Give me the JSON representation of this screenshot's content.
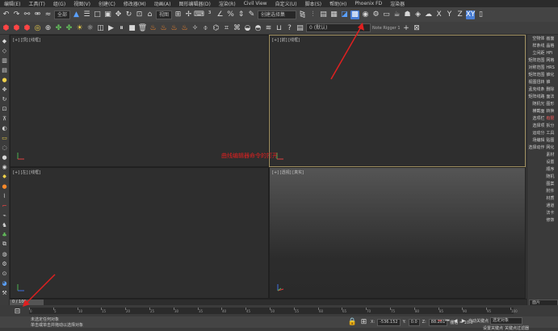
{
  "menubar": [
    "编辑(E)",
    "工具(T)",
    "组(G)",
    "视图(V)",
    "创建(C)",
    "修改器(M)",
    "动画(A)",
    "图形编辑器(D)",
    "渲染(R)",
    "Civil View",
    "自定义(U)",
    "脚本(S)",
    "帮助(H)",
    "Phoenix FD",
    "渲染器"
  ],
  "toolbar1": {
    "filter_dropdown": "全部",
    "selection_set_dropdown": "创建选择集"
  },
  "toolbar2": {
    "layer_dropdown": "0 (默认)",
    "rig_label": "Note Rigger 1"
  },
  "viewports": {
    "top_left_label": "[+] [顶] [线框]",
    "top_right_label": "[+] [前] [线框]",
    "bottom_left_label": "[+] [左] [线框]",
    "bottom_right_label": "[+] [透视] [真实]",
    "annotation": "曲线编辑器命令的打开"
  },
  "right_panel": [
    [
      "空物体",
      "画面"
    ],
    [
      "样条线",
      "晶格"
    ],
    [
      "立间距",
      "HFi"
    ],
    [
      "矩阵范围",
      "网格"
    ],
    [
      "对称范围",
      "HRS"
    ],
    [
      "矩阵范围",
      "锥化"
    ],
    [
      "视图扭转",
      "锥"
    ],
    [
      "孟克线条",
      "删除"
    ],
    [
      "矩阵线路",
      "面法"
    ],
    [
      "随机光",
      "图形"
    ],
    [
      "横截面",
      "转换"
    ],
    [
      "选项栏",
      "有限"
    ],
    [
      "选择项",
      "拆分"
    ],
    [
      "运动分",
      "工具"
    ],
    [
      "场编辑",
      "贴图"
    ],
    [
      "选择动作",
      "网化"
    ],
    [
      "",
      "素材"
    ],
    [
      "",
      "设置"
    ],
    [
      "",
      "顺序"
    ],
    [
      "",
      "随机"
    ],
    [
      "",
      "图案"
    ],
    [
      "",
      "附件"
    ],
    [
      "",
      "材质"
    ],
    [
      "",
      "通道"
    ],
    [
      "",
      "法卡"
    ],
    [
      "",
      "修饰"
    ]
  ],
  "right_panel_dropdown": "面片",
  "timeline": {
    "slider_label": "0 / 100",
    "ticks": [
      "0",
      "5",
      "10",
      "15",
      "20",
      "25",
      "30",
      "35",
      "40",
      "45",
      "50",
      "55",
      "60",
      "65",
      "70",
      "75",
      "80",
      "85",
      "90",
      "95",
      "100"
    ]
  },
  "status": {
    "line1": "未选定任何对象",
    "line2": "单击或单击并拖动以选择对象",
    "x_label": "X:",
    "x_value": "-536.152",
    "y_label": "Y:",
    "y_value": "0.0",
    "z_label": "Z:",
    "z_value": "88.281",
    "grid_label": "栅格 = 10.0",
    "autokey": "自动关键点",
    "selection_dropdown": "选定对象",
    "set_key": "设置关键点",
    "key_filter": "关键点过滤器",
    "maxscript": "MAXScript 迷你"
  }
}
